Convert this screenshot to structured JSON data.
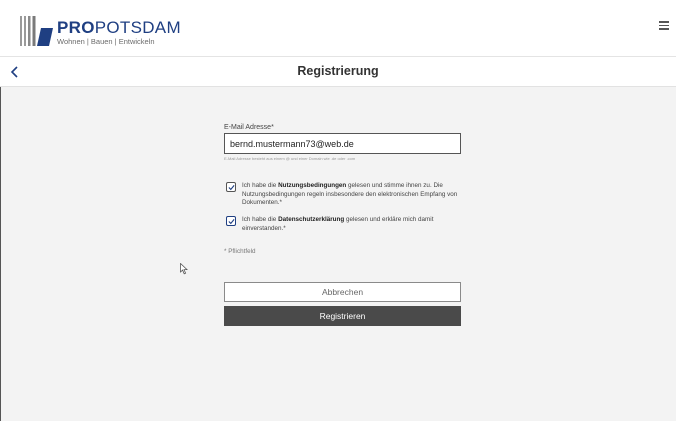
{
  "header": {
    "logo": {
      "brand_bold": "PRO",
      "brand_rest": "POTSDAM",
      "tagline": "Wohnen | Bauen | Entwickeln",
      "icon": "propotsdam-logo-icon",
      "color": "#1f3f82"
    },
    "menu_icon": "hamburger-menu-icon"
  },
  "titlebar": {
    "back_icon": "chevron-left-icon",
    "title": "Registrierung"
  },
  "form": {
    "email": {
      "label": "E-Mail Adresse*",
      "value": "bernd.mustermann73@web.de",
      "hint": "E-Mail Adresse besteht aus einem @ und einer Domain wie .de oder .com"
    },
    "checkboxes": [
      {
        "checked": true,
        "text_before": "Ich habe die ",
        "text_bold": "Nutzungsbedingungen",
        "text_after": " gelesen und stimme ihnen zu. Die Nutzungsbedingungen regeln insbesondere den elektronischen Empfang von Dokumenten.*"
      },
      {
        "checked": true,
        "text_before": "Ich habe die ",
        "text_bold": "Datenschutzerklärung",
        "text_after": " gelesen und erkläre mich damit einverstanden.*"
      }
    ],
    "required_note": "* Pflichtfeld",
    "cancel_label": "Abbrechen",
    "register_label": "Registrieren"
  },
  "colors": {
    "accent": "#1f3f82",
    "button_dark": "#4a4a4a",
    "background": "#f3f3f3"
  }
}
